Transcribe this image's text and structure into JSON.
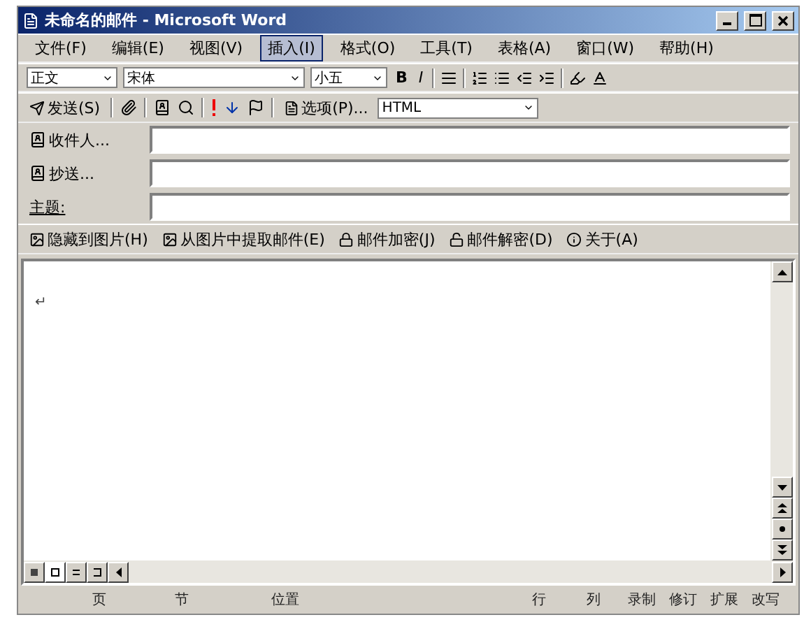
{
  "window": {
    "title": "未命名的邮件 - Microsoft Word"
  },
  "menu": [
    {
      "label": "文件(F)",
      "selected": false
    },
    {
      "label": "编辑(E)",
      "selected": false
    },
    {
      "label": "视图(V)",
      "selected": false
    },
    {
      "label": "插入(I)",
      "selected": true
    },
    {
      "label": "格式(O)",
      "selected": false
    },
    {
      "label": "工具(T)",
      "selected": false
    },
    {
      "label": "表格(A)",
      "selected": false
    },
    {
      "label": "窗口(W)",
      "selected": false
    },
    {
      "label": "帮助(H)",
      "selected": false
    }
  ],
  "format_toolbar": {
    "style": "正文",
    "font": "宋体",
    "size": "小五",
    "bold": "B",
    "italic": "I"
  },
  "mail_toolbar": {
    "send": "发送(S)",
    "options": "选项(P)...",
    "format": "HTML"
  },
  "fields": [
    {
      "label": "收件人...",
      "kind": "button"
    },
    {
      "label": "抄送...",
      "kind": "button"
    },
    {
      "label": "主题:",
      "kind": "text"
    }
  ],
  "plugin_toolbar": [
    "隐藏到图片(H)",
    "从图片中提取邮件(E)",
    "邮件加密(J)",
    "邮件解密(D)",
    "关于(A)"
  ],
  "document": {
    "text": "↵"
  },
  "status_bar": [
    "页",
    "节",
    "位置",
    "行",
    "列",
    "录制",
    "修订",
    "扩展",
    "改写"
  ]
}
